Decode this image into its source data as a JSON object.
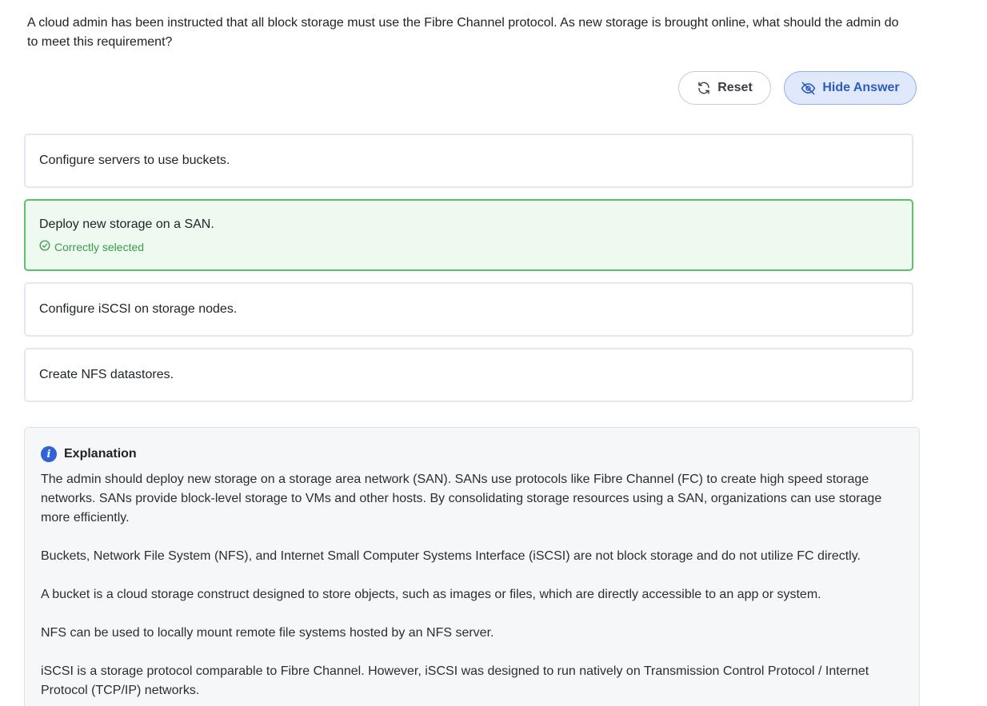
{
  "question": "A cloud admin has been instructed that all block storage must use the Fibre Channel protocol. As new storage is brought online, what should the admin do to meet this requirement?",
  "actions": {
    "reset_label": "Reset",
    "hide_answer_label": "Hide Answer"
  },
  "options": [
    {
      "text": "Configure servers to use buckets."
    },
    {
      "text": "Deploy new storage on a SAN.",
      "status": "Correctly selected"
    },
    {
      "text": "Configure iSCSI on storage nodes."
    },
    {
      "text": "Create NFS datastores."
    }
  ],
  "explanation": {
    "title": "Explanation",
    "paragraphs": [
      "The admin should deploy new storage on a storage area network (SAN). SANs use protocols like Fibre Channel (FC) to create high speed storage networks. SANs provide block-level storage to VMs and other hosts. By consolidating storage resources using a SAN, organizations can use storage more efficiently.",
      "Buckets, Network File System (NFS), and Internet Small Computer Systems Interface (iSCSI) are not block storage and do not utilize FC directly.",
      "A bucket is a cloud storage construct designed to store objects, such as images or files, which are directly accessible to an app or system.",
      "NFS can be used to locally mount remote file systems hosted by an NFS server.",
      "iSCSI is a storage protocol comparable to Fibre Channel. However, iSCSI was designed to run natively on Transmission Control Protocol / Internet Protocol (TCP/IP) networks."
    ]
  },
  "colors": {
    "correct_border": "#5cc16a",
    "correct_text": "#3a9a4a",
    "hide_button_bg": "#dfe9fb",
    "info_icon": "#2f63d6"
  },
  "icons": {
    "reset": "refresh-icon",
    "hide": "eye-off-icon",
    "status": "check-circle-icon",
    "explanation": "info-icon"
  }
}
